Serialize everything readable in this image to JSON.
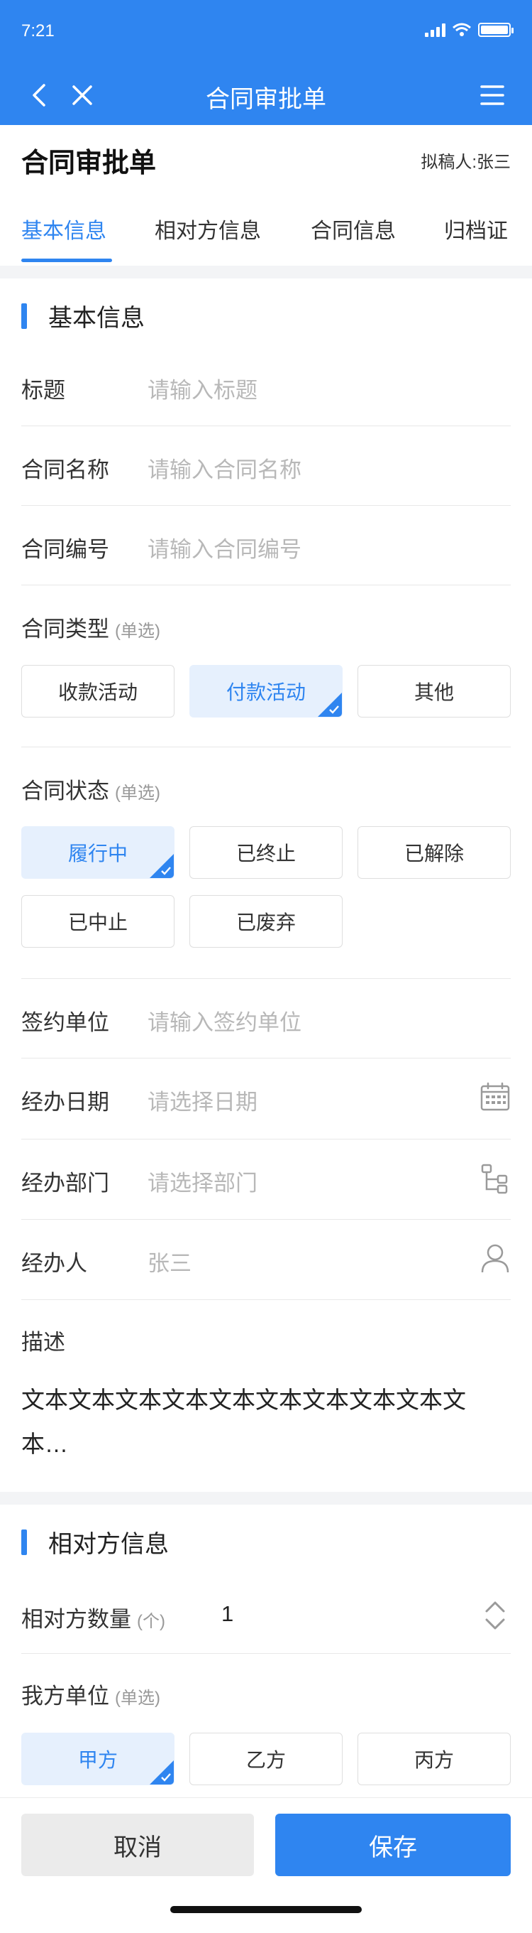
{
  "status_bar": {
    "time": "7:21"
  },
  "nav": {
    "title": "合同审批单"
  },
  "header": {
    "title": "合同审批单",
    "drafter": "拟稿人:张三"
  },
  "tabs": [
    {
      "label": "基本信息"
    },
    {
      "label": "相对方信息"
    },
    {
      "label": "合同信息"
    },
    {
      "label": "归档证"
    }
  ],
  "basic": {
    "heading": "基本信息",
    "title_label": "标题",
    "title_placeholder": "请输入标题",
    "name_label": "合同名称",
    "name_placeholder": "请输入合同名称",
    "number_label": "合同编号",
    "number_placeholder": "请输入合同编号",
    "type_label": "合同类型",
    "type_hint": "(单选)",
    "type_options": [
      "收款活动",
      "付款活动",
      "其他"
    ],
    "type_selected": "付款活动",
    "status_label": "合同状态",
    "status_hint": "(单选)",
    "status_options": [
      "履行中",
      "已终止",
      "已解除",
      "已中止",
      "已废弃"
    ],
    "status_selected": "履行中",
    "unit_label": "签约单位",
    "unit_placeholder": "请输入签约单位",
    "date_label": "经办日期",
    "date_placeholder": "请选择日期",
    "dept_label": "经办部门",
    "dept_placeholder": "请选择部门",
    "handler_label": "经办人",
    "handler_value": "张三",
    "desc_label": "描述",
    "desc_text": "文本文本文本文本文本文本文本文本文本文本…"
  },
  "counterparty": {
    "heading": "相对方信息",
    "count_label": "相对方数量",
    "count_unit": "(个)",
    "count_value": "1",
    "our_unit_label": "我方单位",
    "our_unit_hint": "(单选)",
    "our_unit_options": [
      "甲方",
      "乙方",
      "丙方"
    ],
    "our_unit_selected": "甲方"
  },
  "actions": {
    "cancel_label": "取消",
    "save_label": "保存"
  },
  "colors": {
    "primary": "#2f85f0",
    "chip_selected_bg": "#e6f0fd",
    "divider": "#e8e8e8"
  }
}
